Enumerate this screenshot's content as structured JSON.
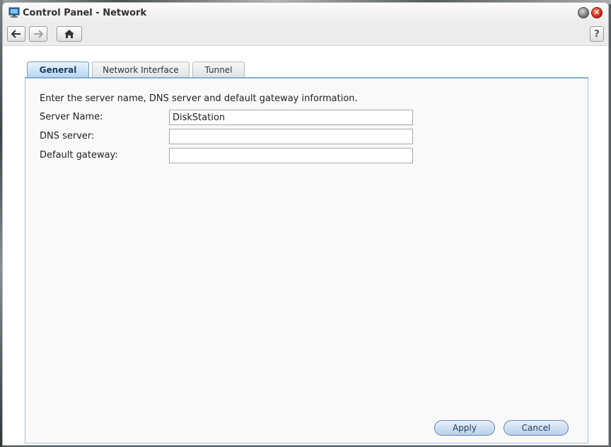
{
  "window": {
    "title": "Control Panel - Network",
    "help_label": "?",
    "close_label": "✕"
  },
  "toolbar": {
    "back_icon": "arrow-left-icon",
    "forward_icon": "arrow-right-icon",
    "home_icon": "home-icon"
  },
  "tabs": [
    {
      "label": "General",
      "selected": true
    },
    {
      "label": "Network Interface",
      "selected": false
    },
    {
      "label": "Tunnel",
      "selected": false
    }
  ],
  "general": {
    "intro": "Enter the server name, DNS server and default gateway information.",
    "fields": [
      {
        "label": "Server Name:",
        "value": "DiskStation"
      },
      {
        "label": "DNS server:",
        "value": ""
      },
      {
        "label": "Default gateway:",
        "value": ""
      }
    ]
  },
  "buttons": {
    "apply": "Apply",
    "cancel": "Cancel"
  },
  "colors": {
    "accent": "#7fb0d9",
    "close": "#c71c0c"
  }
}
